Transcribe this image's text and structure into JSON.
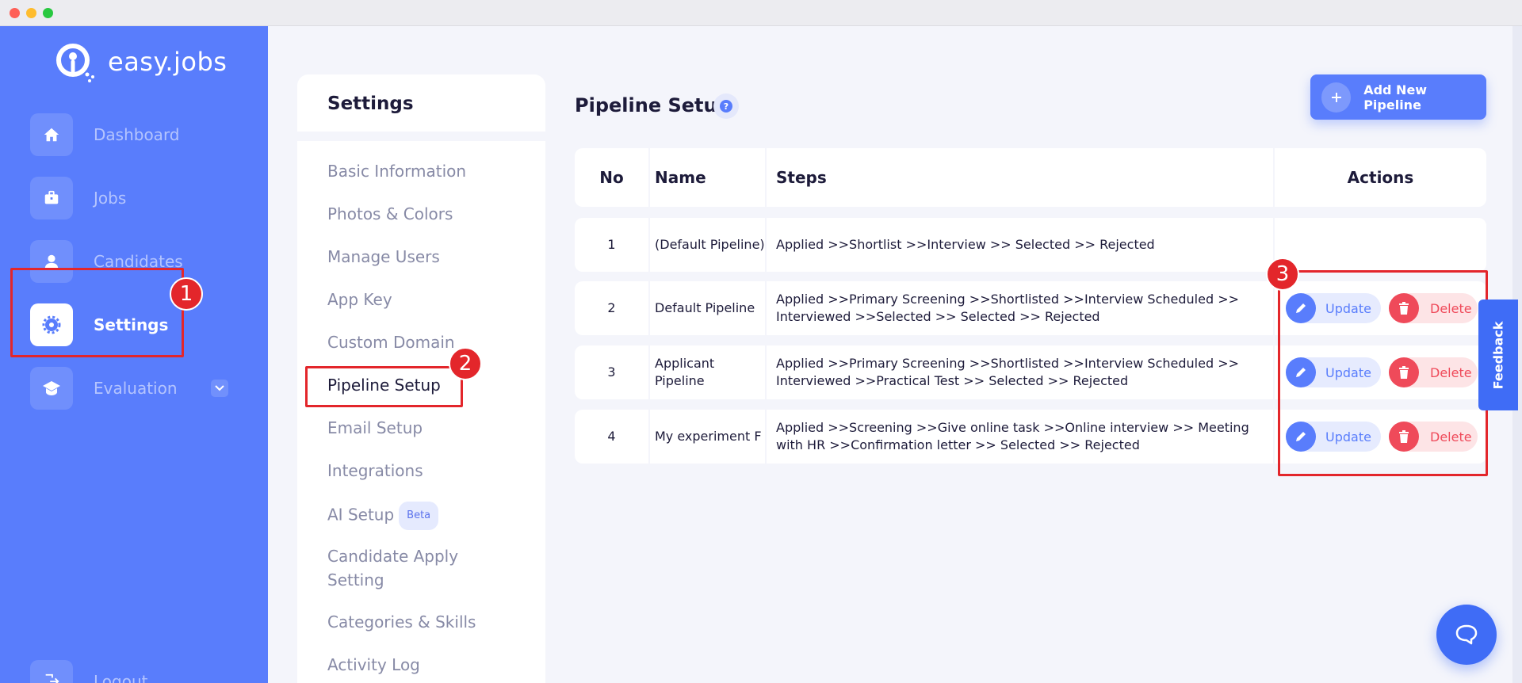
{
  "app": {
    "logo_text": "easy.jobs"
  },
  "sidebar": {
    "items": [
      {
        "label": "Dashboard",
        "icon": "home-icon"
      },
      {
        "label": "Jobs",
        "icon": "briefcase-icon"
      },
      {
        "label": "Candidates",
        "icon": "user-icon"
      },
      {
        "label": "Settings",
        "icon": "gear-icon",
        "active": true
      },
      {
        "label": "Evaluation",
        "icon": "graduation-cap-icon"
      },
      {
        "label": "Logout",
        "icon": "logout-icon"
      }
    ]
  },
  "settings_menu": {
    "title": "Settings",
    "items": [
      {
        "label": "Basic Information"
      },
      {
        "label": "Photos & Colors"
      },
      {
        "label": "Manage Users"
      },
      {
        "label": "App Key"
      },
      {
        "label": "Custom Domain"
      },
      {
        "label": "Pipeline Setup",
        "active": true
      },
      {
        "label": "Email Setup"
      },
      {
        "label": "Integrations"
      },
      {
        "label": "AI Setup",
        "badge": "Beta"
      },
      {
        "label": "Candidate Apply Setting"
      },
      {
        "label": "Categories & Skills"
      },
      {
        "label": "Activity Log"
      }
    ]
  },
  "main": {
    "title": "Pipeline Setup",
    "add_button": "Add New Pipeline",
    "table": {
      "headers": {
        "no": "No",
        "name": "Name",
        "steps": "Steps",
        "actions": "Actions"
      },
      "rows": [
        {
          "no": "1",
          "name": "(Default Pipeline)",
          "steps": "Applied >>Shortlist >>Interview >> Selected >> Rejected",
          "has_actions": false
        },
        {
          "no": "2",
          "name": "Default Pipeline",
          "steps": "Applied >>Primary Screening >>Shortlisted >>Interview Scheduled >> Interviewed >>Selected >> Selected >> Rejected",
          "has_actions": true
        },
        {
          "no": "3",
          "name": "Applicant Pipeline",
          "steps": "Applied >>Primary Screening >>Shortlisted >>Interview Scheduled >> Interviewed >>Practical Test >> Selected >> Rejected",
          "has_actions": true
        },
        {
          "no": "4",
          "name": "My experiment F",
          "steps": "Applied >>Screening >>Give online task >>Online interview >> Meeting with HR >>Confirmation letter >> Selected >> Rejected",
          "has_actions": true
        }
      ],
      "update_label": "Update",
      "delete_label": "Delete"
    }
  },
  "annotations": {
    "n1": "1",
    "n2": "2",
    "n3": "3"
  },
  "feedback_label": "Feedback",
  "colors": {
    "primary": "#597dfc",
    "danger": "#ef4a5a",
    "annotation": "#e3262b"
  }
}
